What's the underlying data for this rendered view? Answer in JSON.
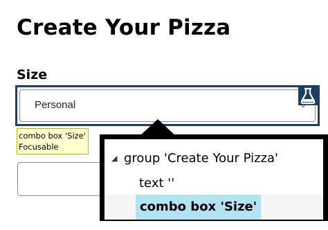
{
  "form": {
    "title": "Create Your Pizza",
    "size_label": "Size",
    "size_select": {
      "value": "Personal"
    }
  },
  "tooltip": {
    "line1": "combo box 'Size'",
    "line2": "Focusable"
  },
  "accessibility_tree": {
    "toggle_glyph": "◢",
    "rows": [
      {
        "label": "group 'Create Your Pizza'"
      },
      {
        "label": "text ''"
      },
      {
        "label": "combo box 'Size'",
        "selected": true
      }
    ]
  },
  "colors": {
    "focus_ring": "#1b3f66",
    "selected_row": "#b3e2f3",
    "tooltip_bg": "#ffffcc"
  },
  "icons": {
    "flask": "flask-icon",
    "chevron": "chevron-down-icon"
  }
}
